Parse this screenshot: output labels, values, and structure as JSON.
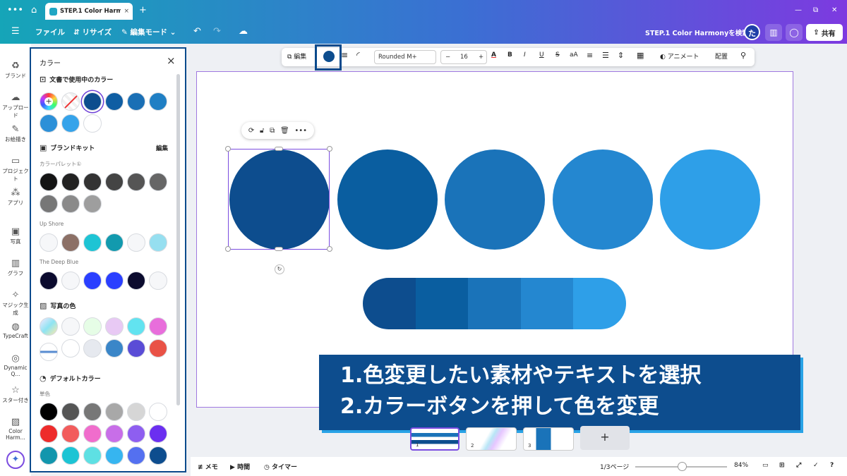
{
  "titlebar": {
    "menu_icon": "more-dots-icon",
    "home_icon": "home-icon",
    "tab_title": "STEP.1 Color Harm...",
    "tab_close": "×",
    "new_tab": "+",
    "window_controls": [
      "—",
      "⧉",
      "✕"
    ]
  },
  "topbar": {
    "menu": "☰",
    "file": "ファイル",
    "resize": "リサイズ",
    "edit_mode": "編集モード",
    "undo": "↶",
    "redo": "↷",
    "cloud": "☁",
    "doc_title": "STEP.1 Color Harmonyを検索",
    "avatar": "た",
    "share": "共有"
  },
  "rail": [
    {
      "icon": "brand-icon",
      "glyph": "♻",
      "label": "ブランド"
    },
    {
      "icon": "upload-icon",
      "glyph": "☁",
      "label": "アップロード"
    },
    {
      "icon": "draw-icon",
      "glyph": "✎",
      "label": "お絵描き"
    },
    {
      "icon": "project-icon",
      "glyph": "▭",
      "label": "プロジェクト"
    },
    {
      "icon": "apps-icon",
      "glyph": "⁂",
      "label": "アプリ"
    },
    {
      "icon": "photo-icon",
      "glyph": "▣",
      "label": "写真"
    },
    {
      "icon": "graph-icon",
      "glyph": "▥",
      "label": "グラフ"
    },
    {
      "icon": "magic-icon",
      "glyph": "✧",
      "label": "マジック生成"
    },
    {
      "icon": "typecraft-icon",
      "glyph": "◍",
      "label": "TypeCraft"
    },
    {
      "icon": "dynamic-icon",
      "glyph": "◎",
      "label": "Dynamic Q..."
    },
    {
      "icon": "star-icon",
      "glyph": "☆",
      "label": "スター付き"
    },
    {
      "icon": "color-harmony-icon",
      "glyph": "▨",
      "label": "Color Harm..."
    }
  ],
  "panel": {
    "title": "カラー",
    "close": "×",
    "doc_colors_title": "文書で使用中のカラー",
    "brand_kit_title": "ブランドキット",
    "brand_kit_edit": "編集",
    "palette1_label": "カラーパレット①",
    "palette2_label": "Up Shore",
    "palette3_label": "The Deep Blue",
    "photo_colors_title": "写真の色",
    "default_colors_title": "デフォルトカラー",
    "solid_label": "単色",
    "doc_colors": [
      "#0d4d8e",
      "#0f5ea3",
      "#1a6fb5",
      "#1f7fc4",
      "#2c90d8",
      "#35a3ea",
      "#ffffff"
    ],
    "palette1": [
      "#141414",
      "#222222",
      "#333333",
      "#444444",
      "#555555",
      "#666666",
      "#777777",
      "#8a8a8a",
      "#9e9e9e"
    ],
    "palette2": [
      "#f6f7f9",
      "#8c7066",
      "#1ec4d4",
      "#129aae",
      "#f6f7f9",
      "#96dff0"
    ],
    "palette3": [
      "#0b0b2e",
      "#f6f7f9",
      "#2a3fff",
      "#2a3fff",
      "#0b0b2e",
      "#f6f7f9"
    ],
    "photo_colors": [
      "#f6f7f9",
      "#e6fde6",
      "#e8c9f4",
      "#62e3f0",
      "#e86edb",
      "#ffffff",
      "#e6e9ef",
      "#3a86c8",
      "#5a4cd6",
      "#e95246"
    ],
    "default_colors": [
      "#000000",
      "#555555",
      "#777777",
      "#a8a8a8",
      "#d6d6d6",
      "#ffffff",
      "#ee2b2b",
      "#f25c5c",
      "#f06dcc",
      "#c86ee8",
      "#8e5ef0",
      "#6b2ff0",
      "#1296ad",
      "#1cc4d4",
      "#5ee0e3",
      "#36b5f0",
      "#5470f0",
      "#0d4d8e"
    ]
  },
  "toolbar": {
    "edit": "編集",
    "font": "Rounded M+",
    "size": "16",
    "minus": "−",
    "plus": "+",
    "text_color": "A",
    "bold": "B",
    "italic": "I",
    "underline": "U",
    "strike": "S",
    "case": "aA",
    "animate": "アニメート",
    "position": "配置"
  },
  "canvas": {
    "circles": [
      "#0d4d8e",
      "#0a5ea0",
      "#1a73b9",
      "#2487d0",
      "#2e9fe8"
    ],
    "strip": [
      "#0d4d8e",
      "#0a5ea0",
      "#1a73b9",
      "#2487d0",
      "#2e9fe8"
    ]
  },
  "banner": {
    "line1": "1.色変更したい素材やテキストを選択",
    "line2": "2.カラーボタンを押して色を変更"
  },
  "pages": [
    {
      "num": "1"
    },
    {
      "num": "2"
    },
    {
      "num": "3"
    }
  ],
  "bottombar": {
    "memo": "メモ",
    "time": "時間",
    "timer": "タイマー",
    "page_indicator": "1/3ページ",
    "zoom": "84%",
    "zoom_value": 84
  }
}
